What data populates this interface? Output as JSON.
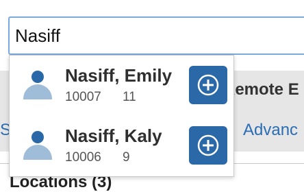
{
  "search": {
    "value": "Nasiff"
  },
  "background": {
    "header_text": "Remote E",
    "left_link": "S",
    "right_link": "Advanc",
    "bottom_text": "Locations (3)"
  },
  "results": [
    {
      "name": "Nasiff, Emily",
      "id": "10007",
      "number": "11",
      "icon": "person-icon",
      "action_icon": "plus-circle-icon"
    },
    {
      "name": "Nasiff, Kaly",
      "id": "10006",
      "number": "9",
      "icon": "person-icon",
      "action_icon": "plus-circle-icon"
    }
  ],
  "colors": {
    "accent": "#2a68a8",
    "link": "#2a6db5",
    "input_border": "#7aa9dd",
    "band": "#e6e6e6"
  }
}
